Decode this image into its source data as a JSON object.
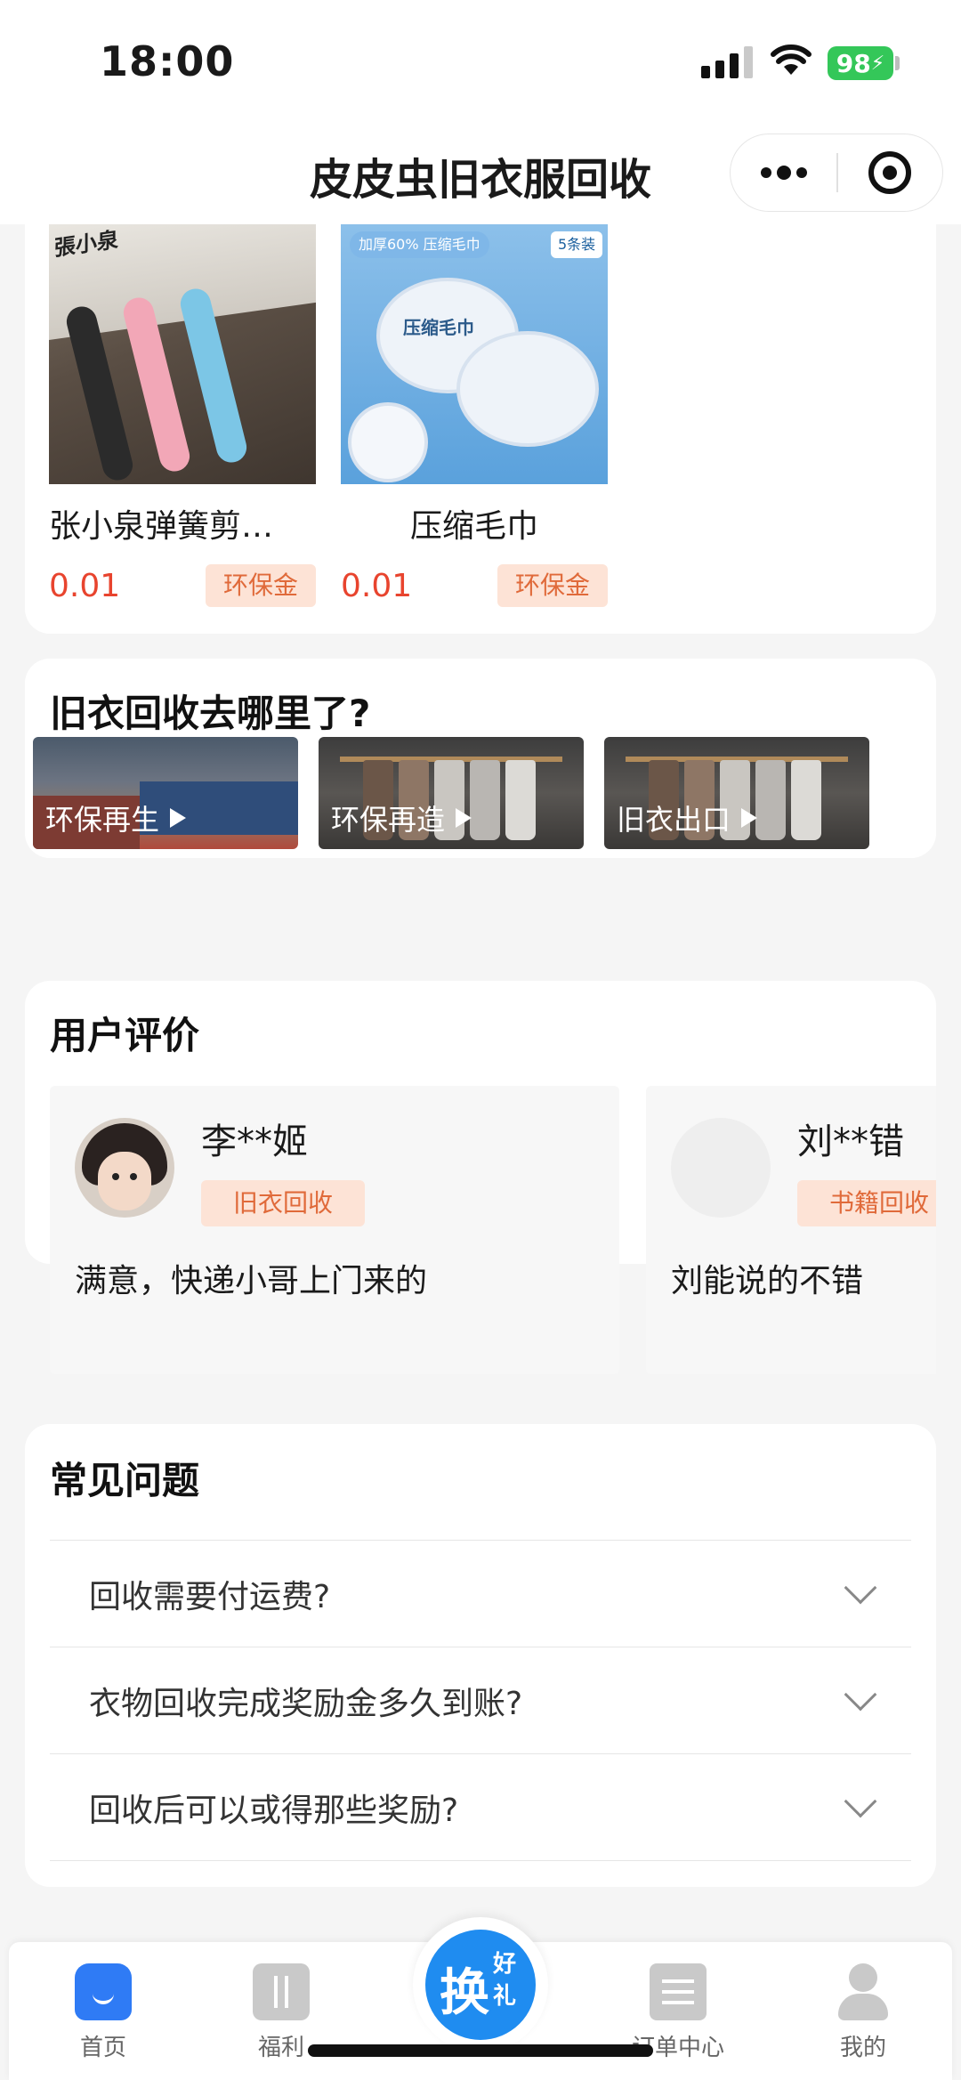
{
  "status_bar": {
    "time": "18:00",
    "battery": "98"
  },
  "nav": {
    "title": "皮皮虫旧衣服回收"
  },
  "products": [
    {
      "name": "张小泉弹簧剪…",
      "price": "0.01",
      "tag": "环保金",
      "image_text": "張小泉"
    },
    {
      "name": "压缩毛巾",
      "price": "0.01",
      "tag": "环保金",
      "image_text": "压缩毛巾",
      "image_badge": "加厚60% 压缩毛巾",
      "image_badge2": "5条装"
    }
  ],
  "where": {
    "title": "旧衣回收去哪里了?",
    "videos": [
      {
        "label": "环保再生"
      },
      {
        "label": "环保再造"
      },
      {
        "label": "旧衣出口"
      }
    ]
  },
  "reviews": {
    "title": "用户评价",
    "items": [
      {
        "name": "李**姬",
        "tag": "旧衣回收",
        "text": "满意，快递小哥上门来的"
      },
      {
        "name": "刘**错",
        "tag": "书籍回收",
        "text": "刘能说的不错"
      }
    ]
  },
  "faq": {
    "title": "常见问题",
    "items": [
      {
        "q": "回收需要付运费?"
      },
      {
        "q": "衣物回收完成奖励金多久到账?"
      },
      {
        "q": "回收后可以或得那些奖励?"
      }
    ]
  },
  "tabs": {
    "home": "首页",
    "welfare": "福利",
    "center_main": "换",
    "center_sub1": "好",
    "center_sub2": "礼",
    "orders": "订单中心",
    "mine": "我的"
  },
  "colors": {
    "accent": "#2f7bf5",
    "price": "#e8442e",
    "tag_bg": "#fde3d6",
    "tag_text": "#e06a3a",
    "battery": "#34c759"
  }
}
